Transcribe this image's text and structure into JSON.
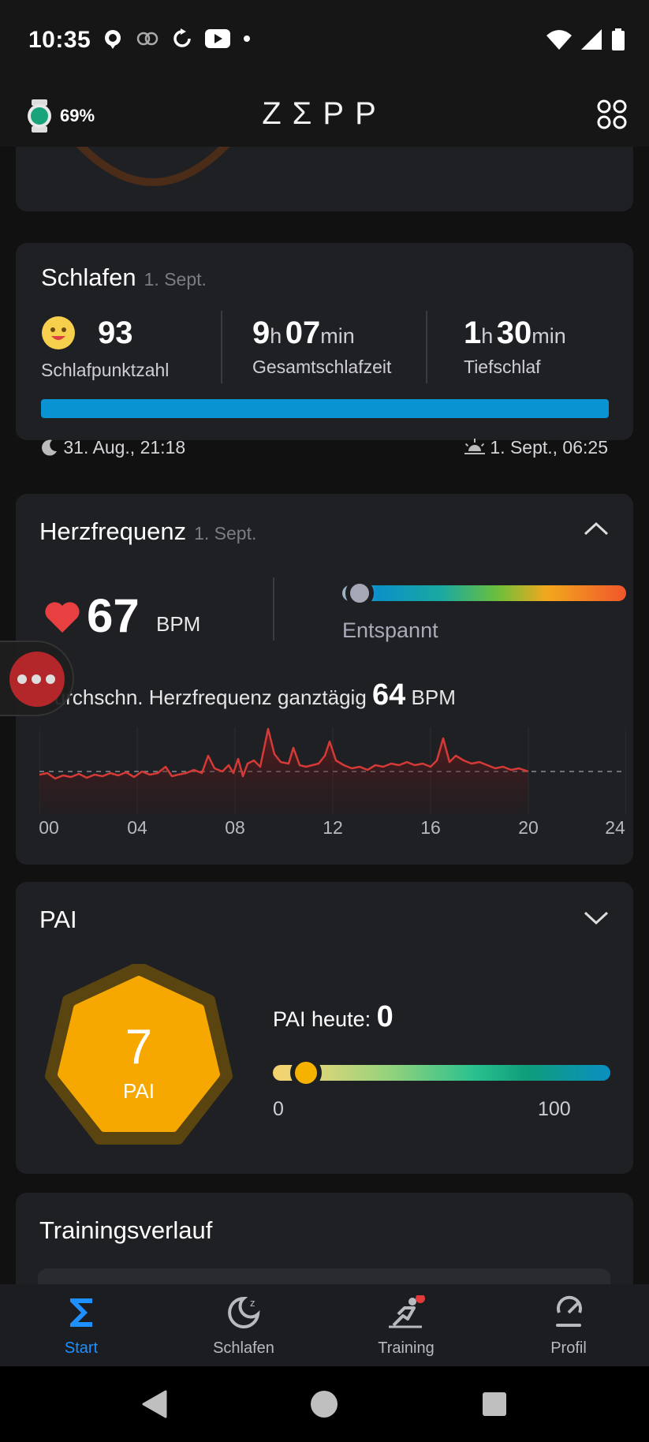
{
  "status_bar": {
    "time": "10:35"
  },
  "header": {
    "battery": "69%",
    "logo": "ZΣPP"
  },
  "sleep": {
    "title": "Schlafen",
    "date": "1. Sept.",
    "score_value": "93",
    "score_label": "Schlafpunktzahl",
    "total_h": "9",
    "total_min": "07",
    "total_label": "Gesamtschlafzeit",
    "deep_h": "1",
    "deep_min": "30",
    "deep_label": "Tiefschlaf",
    "unit_h": "h",
    "unit_min": "min",
    "start": "31. Aug., 21:18",
    "end": "1. Sept., 06:25"
  },
  "heart": {
    "title": "Herzfrequenz",
    "date": "1. Sept.",
    "bpm": "67",
    "bpm_unit": "BPM",
    "zone": "Entspannt",
    "avg_label": "Durchschn. Herzfrequenz ganztägig",
    "avg_value": "64",
    "avg_unit": "BPM",
    "ticks": [
      "00",
      "04",
      "08",
      "12",
      "16",
      "20",
      "24"
    ]
  },
  "pai": {
    "title": "PAI",
    "value": "7",
    "label": "PAI",
    "today_label": "PAI heute:",
    "today_value": "0",
    "min": "0",
    "max": "100",
    "colors": {
      "hex": "#f6a800",
      "ring": "#5a4410"
    }
  },
  "training": {
    "title": "Trainingsverlauf"
  },
  "nav": {
    "start": "Start",
    "sleep": "Schlafen",
    "training": "Training",
    "profile": "Profil"
  },
  "colors": {
    "accent": "#1e90ff",
    "card": "#1f2024",
    "heart": "#e23b3b",
    "sleep_bar": "#0a93d3"
  }
}
